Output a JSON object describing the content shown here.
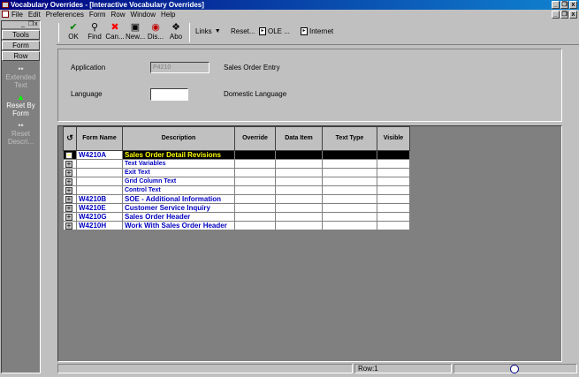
{
  "window": {
    "title": "Vocabulary Overrides - [Interactive Vocabulary Overrides]",
    "minimize": "_",
    "restore": "❐",
    "close": "x"
  },
  "menu": {
    "items": [
      "File",
      "Edit",
      "Preferences",
      "Form",
      "Row",
      "Window",
      "Help"
    ]
  },
  "sidebar": {
    "top_buttons": [
      "Tools",
      "Form",
      "Row"
    ],
    "actions": [
      {
        "label": "Extended Text",
        "icon": "extended-text-icon"
      },
      {
        "label": "Reset By Form",
        "icon": "reset-icon"
      },
      {
        "label": "Reset Descri...",
        "icon": "reset-description-icon"
      }
    ]
  },
  "toolbar": {
    "buttons": [
      {
        "label": "OK",
        "icon": "check-icon",
        "color": "#008000"
      },
      {
        "label": "Find",
        "icon": "find-icon",
        "color": "#000000"
      },
      {
        "label": "Can...",
        "icon": "cancel-icon",
        "color": "#ff0000"
      },
      {
        "label": "New...",
        "icon": "new-icon",
        "color": "#000000"
      },
      {
        "label": "Dis...",
        "icon": "display-icon",
        "color": "#000000"
      },
      {
        "label": "Abo",
        "icon": "about-icon",
        "color": "#000000"
      }
    ],
    "links_label": "Links",
    "reset_label": "Reset...",
    "ole_label": "OLE ...",
    "internet_label": "Internet"
  },
  "form": {
    "application_label": "Application",
    "application_value": "P4210",
    "application_desc": "Sales Order Entry",
    "language_label": "Language",
    "language_value": "",
    "language_desc": "Domestic Language"
  },
  "grid": {
    "headers": [
      "Form Name",
      "Description",
      "Override",
      "Data Item",
      "Text Type",
      "Visible"
    ],
    "rows": [
      {
        "exp": "−",
        "form": "W4210A",
        "desc": "Sales Order Detail Revisions",
        "selected": true,
        "sub": false
      },
      {
        "exp": "+",
        "form": "",
        "desc": "Text Variables",
        "selected": false,
        "sub": true
      },
      {
        "exp": "+",
        "form": "",
        "desc": "Exit Text",
        "selected": false,
        "sub": true
      },
      {
        "exp": "+",
        "form": "",
        "desc": "Grid Column Text",
        "selected": false,
        "sub": true
      },
      {
        "exp": "+",
        "form": "",
        "desc": "Control Text",
        "selected": false,
        "sub": true
      },
      {
        "exp": "+",
        "form": "W4210B",
        "desc": "SOE - Additional Information",
        "selected": false,
        "sub": false
      },
      {
        "exp": "+",
        "form": "W4210E",
        "desc": "Customer Service Inquiry",
        "selected": false,
        "sub": false
      },
      {
        "exp": "+",
        "form": "W4210G",
        "desc": "Sales Order Header",
        "selected": false,
        "sub": false
      },
      {
        "exp": "+",
        "form": "W4210H",
        "desc": "Work With Sales Order Header",
        "selected": false,
        "sub": false
      }
    ]
  },
  "status": {
    "row_text": "Row:1"
  }
}
